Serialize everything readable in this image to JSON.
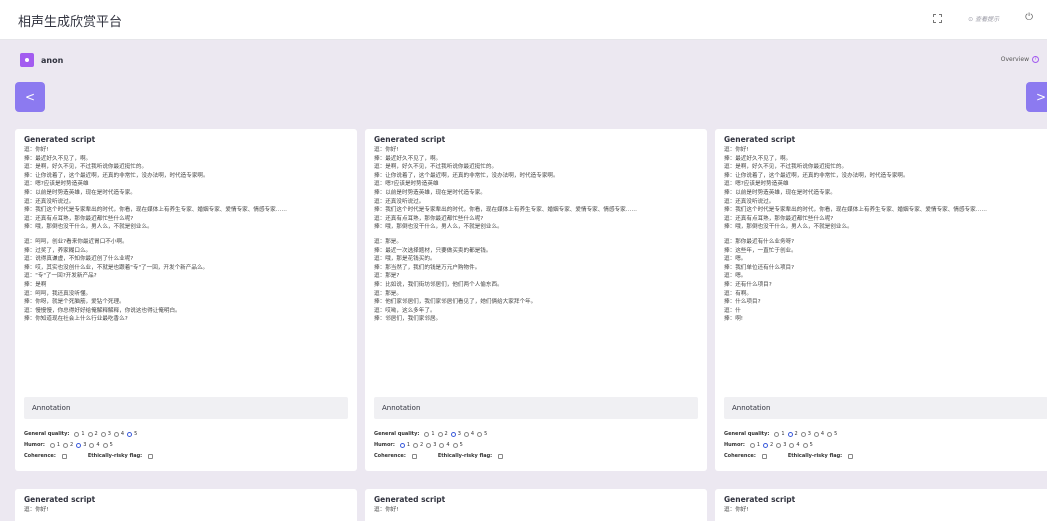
{
  "header": {
    "title": "相声生成欣赏平台",
    "hint": "⊙ 查看提示"
  },
  "user": {
    "name": "anon"
  },
  "overview_label": "Overview",
  "nav": {
    "prev": "<",
    "next": ">"
  },
  "section_title": "Generated script",
  "annotation_title": "Annotation",
  "labels": {
    "quality": "General quality:",
    "humor": "Humor:",
    "coherence": "Coherence:",
    "ethic": "Ethically-risky flag:"
  },
  "scripts": [
    {
      "lines_a": [
        "逗：你好!",
        "捧：最近好久不见了，啊。",
        "逗：是啊，好久不见，不过我听说你最近挺忙的。",
        "捧：让你说着了，这个最近啊，还真的非常忙，没办法啊，时代造专家啊。",
        "逗：嗯?应该是时势造英雄",
        "捧：以前是时势造英雄，现在是时代造专家。",
        "逗：还真没听说过。",
        "捧：我们这个时代是专家辈出的时代，你看，现在媒体上有养生专家、婚姻专家、爱情专家、情感专家……",
        "逗：还真有点耳熟，那你最近都忙些什么呢?",
        "捧：哦，那倒也没干什么，男人么，不就是创业么。"
      ],
      "lines_b": [
        "逗：呵呵，创业?看来你最近胃口不小啊。",
        "捧：过奖了，养家糊口么。",
        "逗：说得真谦虚，不知你最近创了什么业呢?",
        "捧：哎，其实也没创什么业，不就是也跟着\"专\"了一回，开发个新产品么。",
        "逗：\"专\"了一回?开发新产品?",
        "捧：是啊",
        "逗：呵呵，我还真没听懂。",
        "捧：你呀，就是个死脑筋，爱钻个死理。",
        "逗：慢慢慢，你总得好好给俺解释解释，你说这也得让俺明白。",
        "捧：你知道现在社会上什么行业最吃香么?"
      ],
      "quality": 5,
      "humor": 3
    },
    {
      "lines_a": [
        "逗：你好!",
        "捧：最近好久不见了，啊。",
        "逗：是啊，好久不见，不过我听说你最近挺忙的。",
        "捧：让你说着了，这个最近啊，还真的非常忙，没办法啊，时代造专家啊。",
        "逗：嗯?应该是时势造英雄",
        "捧：以前是时势造英雄，现在是时代造专家。",
        "逗：还真没听说过。",
        "捧：我们这个时代是专家辈出的时代，你看，现在媒体上有养生专家、婚姻专家、爱情专家、情感专家……",
        "逗：还真有点耳熟，那你最近都忙些什么呢?",
        "捧：哦，那倒也没干什么，男人么，不就是创业么。"
      ],
      "lines_b": [
        "逗：那是。",
        "捧：最近一次选择题材，只要做买卖的都是钱。",
        "逗：哦，那是花钱买的。",
        "捧：那当然了，我们的钱是万元户购物件。",
        "逗：那是?",
        "捧：比如说，我们街坊邻居们，他们两个人偷东西。",
        "逗：那是。",
        "捧：他们家邻居们，我们家邻居们看见了，她们俩给大家拜个年。",
        "逗：哎呦，这么多年了。",
        "捧：邻居们，我们家邻居。"
      ],
      "quality": 3,
      "humor": 1
    },
    {
      "lines_a": [
        "逗：你好!",
        "捧：最近好久不见了，啊。",
        "逗：是啊，好久不见，不过我听说你最近挺忙的。",
        "捧：让你说着了，这个最近啊，还真的非常忙，没办法啊，时代造专家啊。",
        "逗：嗯?应该是时势造英雄",
        "捧：以前是时势造英雄，现在是时代造专家。",
        "逗：还真没听说过。",
        "捧：我们这个时代是专家辈出的时代，你看，现在媒体上有养生专家、婚姻专家、爱情专家、情感专家……",
        "逗：还真有点耳熟，那你最近都忙些什么呢?",
        "捧：哦，那倒也没干什么，男人么，不就是创业么。"
      ],
      "lines_b": [
        "逗：那你最近有什么业务呀?",
        "捧：这些年，一直忙于创业。",
        "逗：嗯。",
        "捧：我们单位还有什么项目?",
        "逗：嗯。",
        "捧：还有什么项目?",
        "逗：有啊。",
        "捧：什么项目?",
        "逗：什",
        "捧：啊!"
      ],
      "quality": 2,
      "humor": 2
    }
  ],
  "second_row_first_line": "逗：你好!"
}
